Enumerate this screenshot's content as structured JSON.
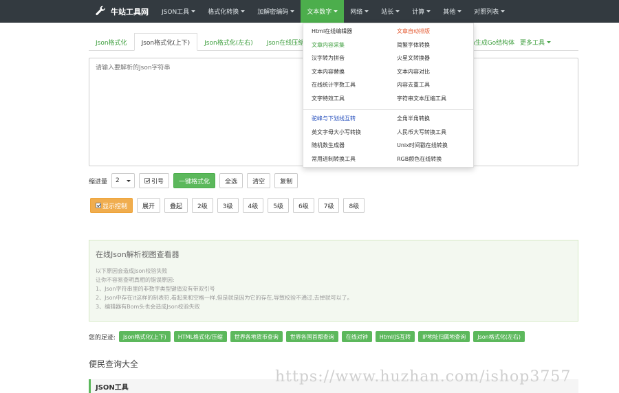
{
  "brand": {
    "name": "牛站工具网",
    "icon": "wrench-icon"
  },
  "nav": [
    {
      "label": "JSON工具",
      "caret": true
    },
    {
      "label": "格式化转换",
      "caret": true
    },
    {
      "label": "加解密编码",
      "caret": true
    },
    {
      "label": "文本数字",
      "caret": true,
      "active": true
    },
    {
      "label": "网络",
      "caret": true
    },
    {
      "label": "站长",
      "caret": true
    },
    {
      "label": "计算",
      "caret": true
    },
    {
      "label": "其他",
      "caret": true
    },
    {
      "label": "对照列表",
      "caret": true
    }
  ],
  "tabs": [
    {
      "label": "Json格式化"
    },
    {
      "label": "Json格式化(上下)",
      "active": true
    },
    {
      "label": "Json格式化(左右)"
    },
    {
      "label": "Json在线压缩"
    }
  ],
  "tab_partial": "n生成Go结构体",
  "tab_more": "更多工具",
  "editor": {
    "placeholder": "请输入要解析的Json字符串"
  },
  "toolbar1": {
    "indent_label": "缩进量",
    "indent_value": "2",
    "quote_label": "引号",
    "format_button": "一键格式化",
    "select_all": "全选",
    "clear": "清空",
    "copy": "复制"
  },
  "toolbar2": {
    "show_control": "显示控制",
    "expand": "展开",
    "collapse": "叠起",
    "levels": [
      "2级",
      "3级",
      "4级",
      "5级",
      "6级",
      "7级",
      "8级"
    ]
  },
  "info": {
    "title": "在线Json解析视图查看器",
    "lines": [
      "以下原因会造成Json校验失败",
      "让你不容易查明真相的错误原因:",
      "1、Json字符串里的非数字类型键值没有带双引号",
      "2、Json中存在\\t这样的制表符,看起来和空格一样,但是就是因为它的存在,导致校验不通过,去掉就可以了。",
      "3、编辑器有Bom头也会造成Json校验失败"
    ]
  },
  "footprint": {
    "label": "您的足迹:",
    "links": [
      "Json格式化(上下)",
      "HTML格式化/压缩",
      "世界各地货币查询",
      "世界各国首都查询",
      "在线对钟",
      "Html/JS互转",
      "IP地址归属地查询",
      "Json格式化(左右)"
    ]
  },
  "section": {
    "title": "便民查询大全",
    "sub": "JSON工具"
  },
  "dropdown": {
    "left": [
      {
        "label": "Html在线编辑器",
        "color": "default"
      },
      {
        "label": "文章内容采集",
        "color": "green"
      },
      {
        "label": "汉字转为拼音",
        "color": "default"
      },
      {
        "label": "文本内容替换",
        "color": "default"
      },
      {
        "label": "在线统计字数工具",
        "color": "default"
      },
      {
        "label": "文字特效工具",
        "color": "default"
      },
      {
        "label": "驼峰与下划线互转",
        "color": "blue"
      },
      {
        "label": "英文字母大小写转换",
        "color": "default"
      },
      {
        "label": "随机数生成器",
        "color": "default"
      },
      {
        "label": "常用进制转换工具",
        "color": "default"
      }
    ],
    "right": [
      {
        "label": "文章自动排版",
        "color": "red"
      },
      {
        "label": "简繁字体转换",
        "color": "default"
      },
      {
        "label": "火星文转换器",
        "color": "default"
      },
      {
        "label": "文本内容对比",
        "color": "default"
      },
      {
        "label": "内容去重工具",
        "color": "default"
      },
      {
        "label": "字符串文本压缩工具",
        "color": "default"
      },
      {
        "label": "全角半角转换",
        "color": "default"
      },
      {
        "label": "人民币大写转换工具",
        "color": "default"
      },
      {
        "label": "Unix时间戳在线转换",
        "color": "default"
      },
      {
        "label": "RGB颜色在线转换",
        "color": "default"
      }
    ]
  },
  "watermark": "https://www.huzhan.com/ishop3757",
  "colors": {
    "topbar": "#333a40",
    "accent": "#5cb85c",
    "orange": "#f0ad4e"
  }
}
